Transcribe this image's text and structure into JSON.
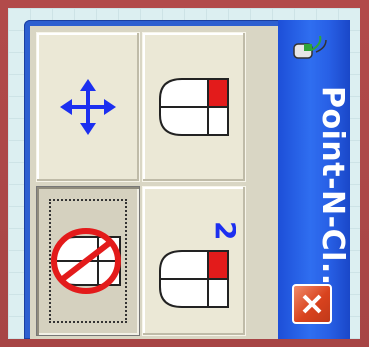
{
  "window": {
    "title": "Point-N-Cl...",
    "close_icon": "close-icon",
    "app_icon": "mouse-app-icon"
  },
  "buttons": [
    {
      "name": "move-button",
      "icon": "move-arrows-icon",
      "pressed": false
    },
    {
      "name": "left-click-button",
      "icon": "mouse-right-click-icon",
      "pressed": false
    },
    {
      "name": "no-click-button",
      "icon": "mouse-disabled-icon",
      "pressed": true
    },
    {
      "name": "double-click-button",
      "icon": "mouse-double-click-icon",
      "label": "2",
      "pressed": false
    }
  ],
  "colors": {
    "titlebar": "#2860e6",
    "accent_red": "#e31b1b",
    "arrow_blue": "#1c2ff0",
    "close_red": "#d9431e"
  }
}
